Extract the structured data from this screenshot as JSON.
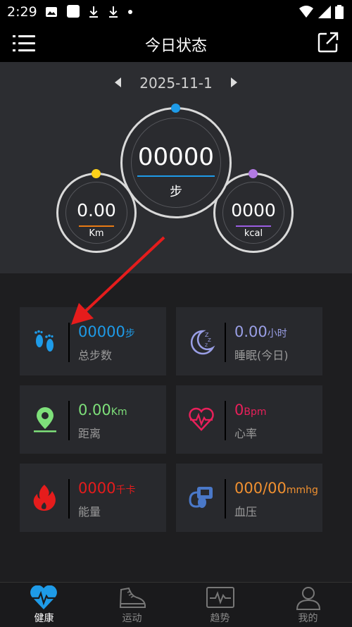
{
  "status_bar": {
    "time": "2:29",
    "icons": [
      "image-icon",
      "square-icon",
      "download-icon",
      "download-icon",
      "dot-icon"
    ],
    "right_icons": [
      "wifi-icon",
      "signal-icon",
      "battery-icon"
    ]
  },
  "app_bar": {
    "title": "今日状态"
  },
  "date_nav": {
    "date": "2025-11-1"
  },
  "rings": {
    "steps": {
      "value": "00000",
      "unit": "步",
      "accent": "#1e9be8"
    },
    "distance": {
      "value": "0.00",
      "unit": "Km",
      "accent": "#ffd21a"
    },
    "calories": {
      "value": "0000",
      "unit": "kcal",
      "accent": "#b27ae3"
    }
  },
  "cards": {
    "steps": {
      "value": "00000",
      "unit": "步",
      "label": "总步数",
      "color": "#1e9be8"
    },
    "sleep": {
      "value": "0.00",
      "unit": "小时",
      "label": "睡眠(今日)",
      "color": "#9a9fe6"
    },
    "distance": {
      "value": "0.00",
      "unit": "Km",
      "label": "距离",
      "color": "#7ee07a"
    },
    "heart": {
      "value": "0",
      "unit": "Bpm",
      "label": "心率",
      "color": "#e8205a"
    },
    "energy": {
      "value": "0000",
      "unit": "千卡",
      "label": "能量",
      "color": "#e51c1c"
    },
    "blood": {
      "value": "000/00",
      "unit": "mmhg",
      "label": "血压",
      "color": "#f09030"
    }
  },
  "bottom_nav": [
    {
      "label": "健康",
      "icon": "heart-pulse-icon",
      "active": true
    },
    {
      "label": "运动",
      "icon": "shoe-icon",
      "active": false
    },
    {
      "label": "趋势",
      "icon": "trend-icon",
      "active": false
    },
    {
      "label": "我的",
      "icon": "person-icon",
      "active": false
    }
  ]
}
